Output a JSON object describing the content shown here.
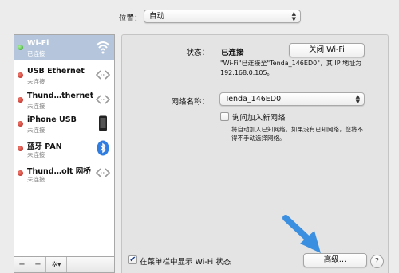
{
  "location": {
    "label": "位置：",
    "value": "自动"
  },
  "sidebar": {
    "items": [
      {
        "name": "Wi-Fi",
        "status": "已连接",
        "indicator": "green",
        "icon": "wifi-icon",
        "selected": true
      },
      {
        "name": "USB Ethernet",
        "status": "未连接",
        "indicator": "red",
        "icon": "network-arrows-icon",
        "selected": false
      },
      {
        "name": "Thund…thernet",
        "status": "未连接",
        "indicator": "red",
        "icon": "network-arrows-icon",
        "selected": false
      },
      {
        "name": "iPhone USB",
        "status": "未连接",
        "indicator": "red",
        "icon": "iphone-icon",
        "selected": false
      },
      {
        "name": "蓝牙 PAN",
        "status": "未连接",
        "indicator": "red",
        "icon": "bluetooth-icon",
        "selected": false
      },
      {
        "name": "Thund…olt 网桥",
        "status": "未连接",
        "indicator": "red",
        "icon": "network-arrows-icon",
        "selected": false
      }
    ],
    "buttons": {
      "add": "+",
      "remove": "−",
      "gear": "✲▾"
    }
  },
  "main": {
    "status_label": "状态：",
    "status_value": "已连接",
    "wifi_off_button": "关闭 Wi-Fi",
    "status_description": "\"Wi-Fi\"已连接至\"Tenda_146ED0\"，其 IP 地址为 192.168.0.105。",
    "network_name_label": "网络名称：",
    "network_name_value": "Tenda_146ED0",
    "ask_join_label": "询问加入新网络",
    "ask_join_checked": false,
    "ask_join_description": "将自动加入已知网络。如果没有已知网络，您将不得不手动选择网络。",
    "show_in_menubar_label": "在菜单栏中显示 Wi-Fi 状态",
    "show_in_menubar_checked": true,
    "advanced_button": "高级…",
    "help_button": "?"
  },
  "colors": {
    "selection": "#b5c6dc",
    "arrow": "#3b8fe0",
    "status_green": "#2f9e27",
    "status_red": "#b3221a"
  }
}
